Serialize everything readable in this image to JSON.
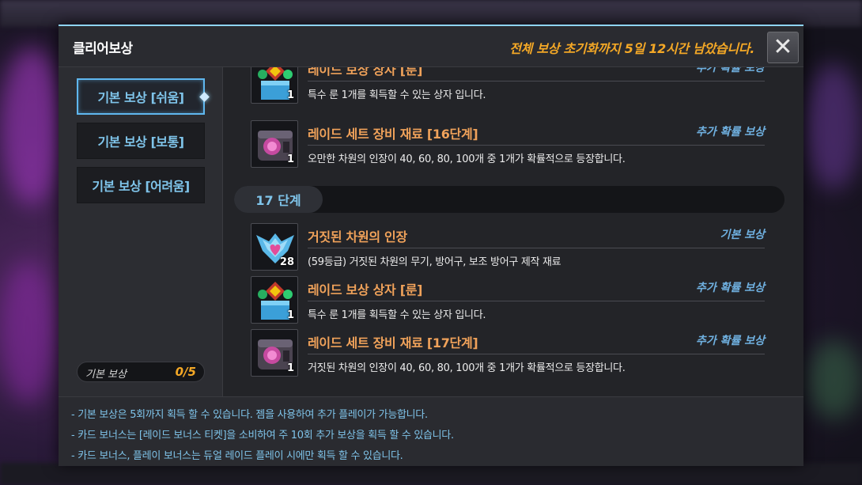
{
  "dialog": {
    "title": "클리어보상",
    "reset_notice": "전체 보상 초기화까지 5일 12시간 남았습니다.",
    "close_icon": "close-icon"
  },
  "tabs": [
    {
      "label": "기본 보상 [쉬움]",
      "active": true
    },
    {
      "label": "기본 보상 [보통]",
      "active": false
    },
    {
      "label": "기본 보상 [어려움]",
      "active": false
    }
  ],
  "progress": {
    "label": "기본 보상",
    "count": "0/5"
  },
  "stage": {
    "label": "17 단계"
  },
  "rewards_above": [
    {
      "name": "레이드 보상 상자 [룬]",
      "type": "추가 확률 보상",
      "qty": "1",
      "desc": "특수 룬 1개를 획득할 수 있는 상자 입니다.",
      "icon": "rune-box-icon"
    },
    {
      "name": "레이드 세트 장비 재료 [16단계]",
      "type": "추가 확률 보상",
      "qty": "1",
      "desc": "오만한 차원의 인장이 40, 60, 80, 100개 중 1개가 확률적으로 등장합니다.",
      "icon": "set-material-icon"
    }
  ],
  "rewards_stage": [
    {
      "name": "거짓된 차원의 인장",
      "type": "기본 보상",
      "qty": "28",
      "desc": "(59등급) 거짓된 차원의 무기, 방어구, 보조 방어구 제작 재료",
      "icon": "dimension-seal-icon"
    },
    {
      "name": "레이드 보상 상자 [룬]",
      "type": "추가 확률 보상",
      "qty": "1",
      "desc": "특수 룬 1개를 획득할 수 있는 상자 입니다.",
      "icon": "rune-box-icon"
    },
    {
      "name": "레이드 세트 장비 재료 [17단계]",
      "type": "추가 확률 보상",
      "qty": "1",
      "desc": "거짓된 차원의 인장이 40, 60, 80, 100개 중 1개가 확률적으로 등장합니다.",
      "icon": "set-material-icon"
    }
  ],
  "footer": [
    "- 기본 보상은 5회까지 획득 할 수 있습니다. 젬을 사용하여 추가 플레이가 가능합니다.",
    "- 카드 보너스는 [레이드 보너스 티켓]을 소비하여 주 10회 추가 보상을 획득 할 수 있습니다.",
    "- 카드 보너스, 플레이 보너스는 듀얼 레이드 플레이 시에만 획득 할 수 있습니다."
  ],
  "colors": {
    "accent": "#7fc4ea",
    "gold": "#f4a826",
    "item_name": "#f0a25a"
  }
}
